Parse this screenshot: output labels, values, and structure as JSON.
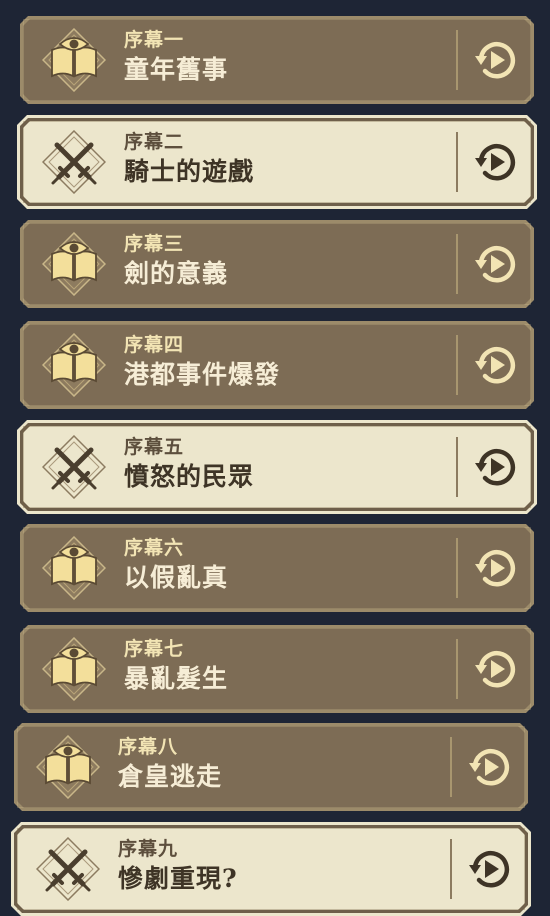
{
  "chapters": [
    {
      "chapter": "序幕一",
      "title": "童年舊事",
      "style": "dark",
      "icon": "book-eye-icon"
    },
    {
      "chapter": "序幕二",
      "title": "騎士的遊戲",
      "style": "light",
      "icon": "crossed-swords-icon"
    },
    {
      "chapter": "序幕三",
      "title": "劍的意義",
      "style": "dark",
      "icon": "book-eye-icon"
    },
    {
      "chapter": "序幕四",
      "title": "港都事件爆發",
      "style": "dark",
      "icon": "book-eye-icon"
    },
    {
      "chapter": "序幕五",
      "title": "憤怒的民眾",
      "style": "light",
      "icon": "crossed-swords-icon"
    },
    {
      "chapter": "序幕六",
      "title": "以假亂真",
      "style": "dark",
      "icon": "book-eye-icon"
    },
    {
      "chapter": "序幕七",
      "title": "暴亂髮生",
      "style": "dark",
      "icon": "book-eye-icon"
    },
    {
      "chapter": "序幕八",
      "title": "倉皇逃走",
      "style": "dark",
      "icon": "book-eye-icon"
    },
    {
      "chapter": "序幕九",
      "title": "慘劇重現?",
      "style": "light",
      "icon": "crossed-swords-icon"
    }
  ],
  "replay_icon": "replay-icon",
  "colors": {
    "background": "#1e2535",
    "dark_card": "#7d6c55",
    "light_card": "#ece6cc",
    "accent_gold": "#f2e4b4"
  }
}
